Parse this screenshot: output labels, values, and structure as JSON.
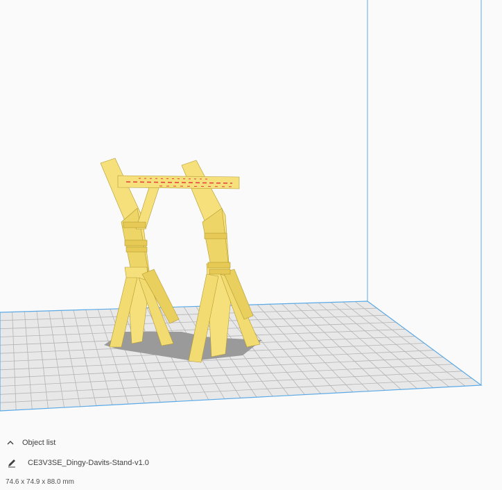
{
  "viewport": {
    "label": "3D build plate viewport",
    "model_name": "CE3V3SE_Dingy-Davits-Stand-v1.0",
    "colors": {
      "background": "#f7f7f7",
      "plate": "#e8e8e8",
      "grid": "#b4b4b4",
      "volume_edge": "#5aa9e6",
      "model": "#f5e07c",
      "model_dark": "#d8c04a",
      "overhang": "#e43a3a",
      "shadow": "#9a9a9a"
    }
  },
  "object_list": {
    "toggle_label": "Object list",
    "toggle_icon": "chevron-up-icon",
    "item": {
      "icon": "pencil-icon",
      "name": "CE3V3SE_Dingy-Davits-Stand-v1.0"
    },
    "dimensions": "74.6 x 74.9 x 88.0 mm"
  }
}
